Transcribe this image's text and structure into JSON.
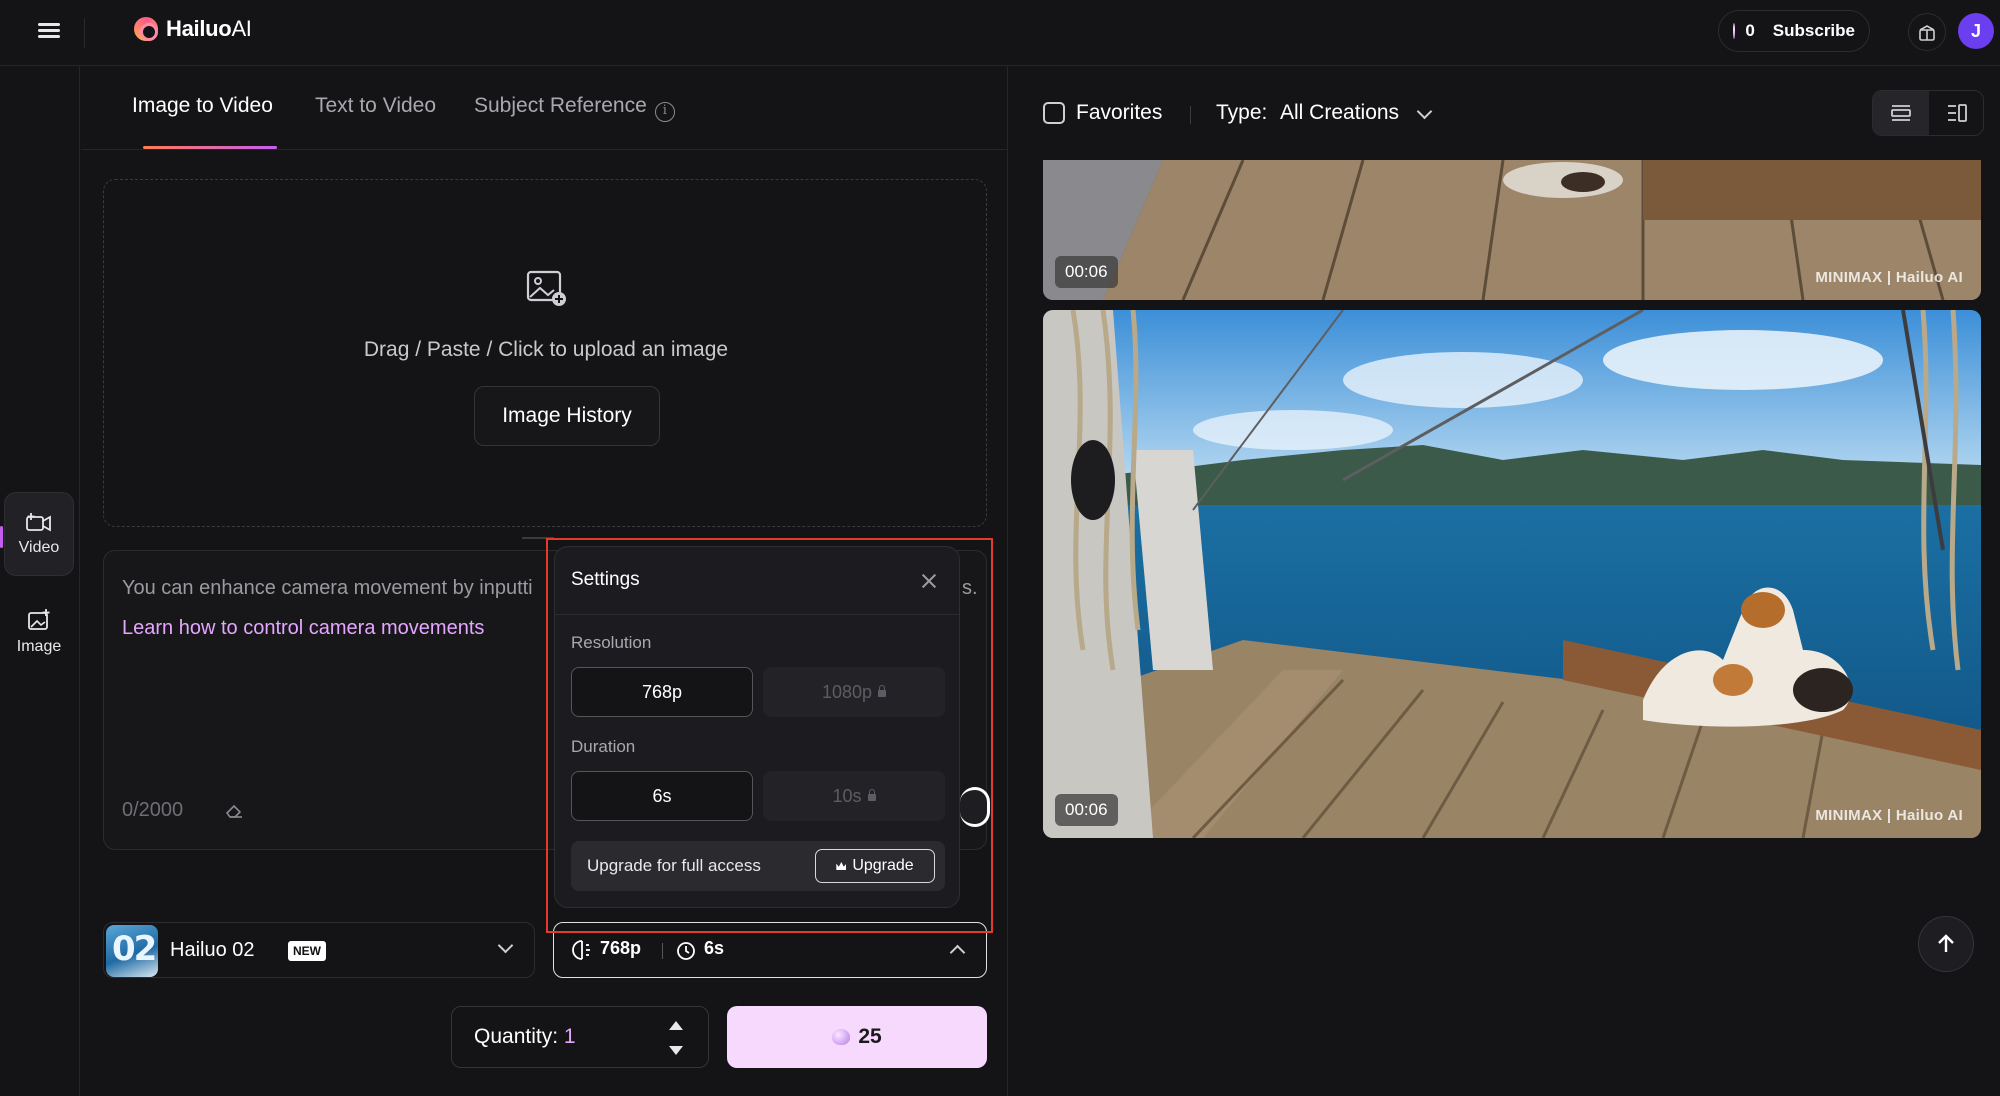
{
  "app": {
    "logo_name": "Hailuo",
    "logo_suffix": "AI",
    "credits": "0",
    "subscribe_label": "Subscribe",
    "avatar_initial": "J",
    "accent_color": "#c65df0"
  },
  "rail": {
    "items": [
      {
        "label": "Video",
        "icon": "video-plus-icon",
        "active": true
      },
      {
        "label": "Image",
        "icon": "image-plus-icon",
        "active": false
      }
    ]
  },
  "tabs": [
    {
      "label": "Image to Video",
      "active": true
    },
    {
      "label": "Text to Video",
      "active": false
    },
    {
      "label": "Subject Reference",
      "active": false
    }
  ],
  "upload": {
    "text": "Drag / Paste / Click to upload an image",
    "history_button": "Image History"
  },
  "prompt": {
    "hint": "You can enhance camera movement by inputti",
    "hint_tail": "s.",
    "link": "Learn how to control camera movements",
    "count": "0/2000"
  },
  "model": {
    "name": "Hailuo 02",
    "badge": "NEW",
    "thumb_text": "02"
  },
  "settings_summary": {
    "resolution": "768p",
    "duration": "6s"
  },
  "settings_popup": {
    "title": "Settings",
    "resolution_label": "Resolution",
    "resolution_options": [
      {
        "label": "768p",
        "selected": true,
        "locked": false
      },
      {
        "label": "1080p",
        "selected": false,
        "locked": true
      }
    ],
    "duration_label": "Duration",
    "duration_options": [
      {
        "label": "6s",
        "selected": true,
        "locked": false
      },
      {
        "label": "10s",
        "selected": false,
        "locked": true
      }
    ],
    "upgrade_text": "Upgrade for full access",
    "upgrade_button": "Upgrade"
  },
  "quantity": {
    "label": "Quantity: ",
    "value": "1"
  },
  "generate": {
    "cost": "25"
  },
  "gallery": {
    "favorites_label": "Favorites",
    "type_label": "Type:",
    "type_value": "All Creations",
    "videos": [
      {
        "duration": "00:06",
        "watermark": "MINIMAX | Hailuo AI"
      },
      {
        "duration": "00:06",
        "watermark": "MINIMAX | Hailuo AI"
      }
    ]
  }
}
